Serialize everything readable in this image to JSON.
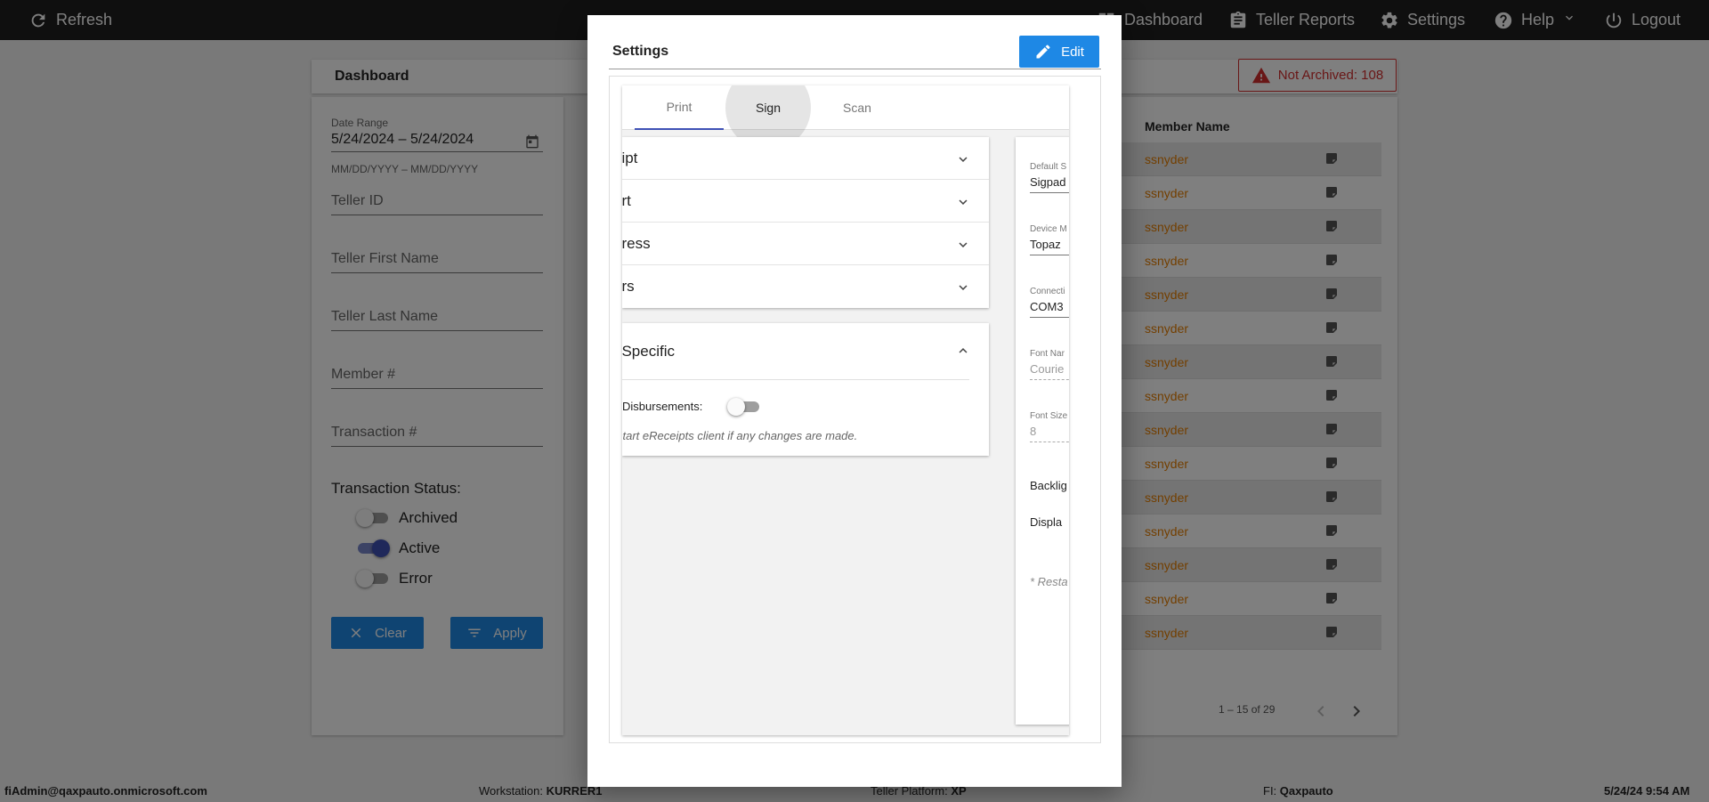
{
  "topbar": {
    "refresh_label": "Refresh",
    "dashboard_label": "Dashboard",
    "teller_reports_label": "Teller Reports",
    "settings_label": "Settings",
    "help_label": "Help",
    "logout_label": "Logout"
  },
  "dashboard": {
    "title": "Dashboard",
    "not_archived_label": "Not Archived: 108"
  },
  "filters": {
    "date_range_label": "Date Range",
    "date_range_value": "5/24/2024 – 5/24/2024",
    "date_range_hint": "MM/DD/YYYY – MM/DD/YYYY",
    "teller_id_placeholder": "Teller ID",
    "teller_first_name_placeholder": "Teller First Name",
    "teller_last_name_placeholder": "Teller Last Name",
    "member_placeholder": "Member #",
    "transaction_placeholder": "Transaction #",
    "status_title": "Transaction Status:",
    "statuses": [
      {
        "label": "Archived",
        "on": false
      },
      {
        "label": "Active",
        "on": true
      },
      {
        "label": "Error",
        "on": false
      }
    ],
    "clear_label": "Clear",
    "apply_label": "Apply"
  },
  "table": {
    "member_name_header": "Member Name",
    "rows": [
      "ssnyder",
      "ssnyder",
      "ssnyder",
      "ssnyder",
      "ssnyder",
      "ssnyder",
      "ssnyder",
      "ssnyder",
      "ssnyder",
      "ssnyder",
      "ssnyder",
      "ssnyder",
      "ssnyder",
      "ssnyder",
      "ssnyder"
    ],
    "pager_text": "1 – 15 of 29"
  },
  "footer": {
    "user": "fiAdmin@qaxpauto.onmicrosoft.com",
    "workstation_label": "Workstation:",
    "workstation_value": "KURRER1",
    "platform_label": "Teller Platform:",
    "platform_value": "XP",
    "fi_label": "FI:",
    "fi_value": "Qaxpauto",
    "datetime": "5/24/24 9:54 AM"
  },
  "modal": {
    "title": "Settings",
    "edit_label": "Edit",
    "tabs": [
      "Print",
      "Sign",
      "Scan"
    ],
    "accordion": [
      "eipt",
      "ort",
      "press",
      "ers"
    ],
    "specific_title": "t Specific",
    "disbursements_label": "Disbursements:",
    "disbursements_on": false,
    "restart_note": "start eReceipts client if any changes are made.",
    "right_fields": [
      {
        "label": "Default S",
        "value": "Sigpad",
        "disabled": false
      },
      {
        "label": "Device M",
        "value": "Topaz",
        "disabled": false
      },
      {
        "label": "Connecti",
        "value": "COM3",
        "disabled": false
      },
      {
        "label": "Font Nar",
        "value": "Courie",
        "disabled": true
      },
      {
        "label": "Font Size",
        "value": "8",
        "disabled": true
      }
    ],
    "backlight_label": "Backlig",
    "display_label": "Displa",
    "right_note": "* Resta"
  },
  "colors": {
    "accent_blue": "#1e88e5",
    "toggle_indigo": "#3f51b5",
    "alert_red": "#d32f2f",
    "member_orange": "#e67e00"
  }
}
